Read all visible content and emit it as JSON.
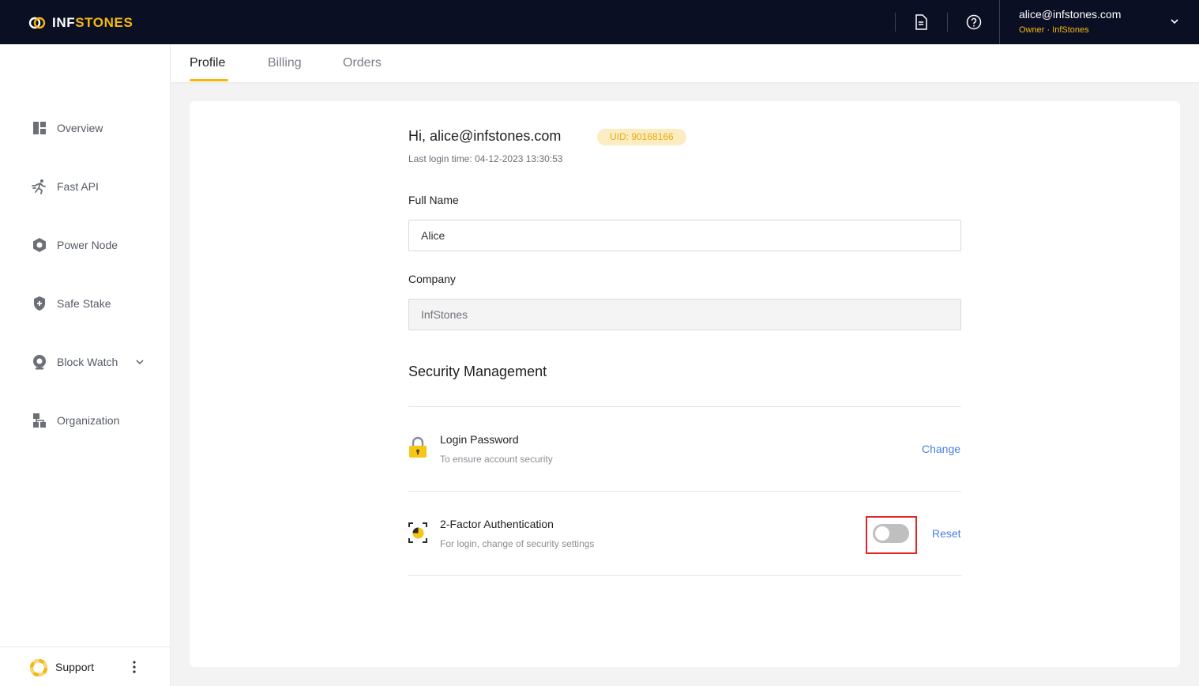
{
  "colors": {
    "topbar_bg": "#0b0f24",
    "accent": "#f5b80e",
    "link": "#4a7fe0",
    "highlight": "#e3262a"
  },
  "header": {
    "logo_left": "INF",
    "logo_right": "STONES",
    "icons": [
      "document-icon",
      "help-icon"
    ],
    "user_email": "alice@infstones.com",
    "user_role": "Owner · InfStones"
  },
  "sidebar": {
    "items": [
      {
        "label": "Overview",
        "icon": "overview-icon"
      },
      {
        "label": "Fast API",
        "icon": "fast-api-icon"
      },
      {
        "label": "Power Node",
        "icon": "power-node-icon"
      },
      {
        "label": "Safe Stake",
        "icon": "shield-icon"
      },
      {
        "label": "Block Watch",
        "icon": "block-watch-icon",
        "expandable": true
      },
      {
        "label": "Organization",
        "icon": "organization-icon"
      }
    ],
    "support_label": "Support"
  },
  "tabs": [
    {
      "label": "Profile",
      "active": true
    },
    {
      "label": "Billing",
      "active": false
    },
    {
      "label": "Orders",
      "active": false
    }
  ],
  "profile": {
    "greeting": "Hi, alice@infstones.com",
    "uid": "UID: 90168166",
    "last_login": "Last login time: 04-12-2023 13:30:53",
    "full_name_label": "Full Name",
    "full_name_value": "Alice",
    "company_label": "Company",
    "company_value": "InfStones"
  },
  "security": {
    "title": "Security Management",
    "password": {
      "title": "Login Password",
      "desc": "To ensure account security",
      "action": "Change"
    },
    "two_factor": {
      "title": "2-Factor Authentication",
      "desc": "For login, change of security settings",
      "enabled": false,
      "action": "Reset"
    }
  }
}
